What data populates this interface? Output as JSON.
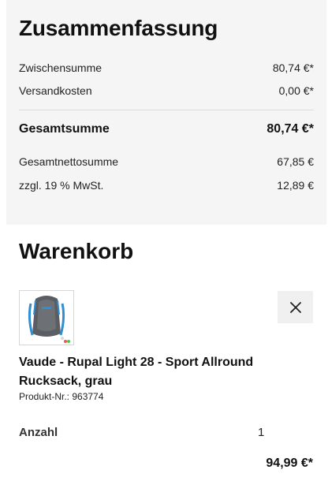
{
  "summary": {
    "title": "Zusammenfassung",
    "subtotal_label": "Zwischensumme",
    "subtotal_value": "80,74 €*",
    "shipping_label": "Versandkosten",
    "shipping_value": "0,00 €*",
    "total_label": "Gesamtsumme",
    "total_value": "80,74 €*",
    "net_label": "Gesamtnettosumme",
    "net_value": "67,85 €",
    "vat_label": "zzgl. 19 % MwSt.",
    "vat_value": "12,89 €"
  },
  "cart": {
    "title": "Warenkorb",
    "item": {
      "image_icon": "backpack-image",
      "remove_icon": "close-icon",
      "name": "Vaude - Rupal Light 28 - Sport Allround Rucksack, grau",
      "product_number": "Produkt-Nr.: 963774",
      "quantity_label": "Anzahl",
      "quantity_value": "1",
      "price": "94,99 €*"
    }
  },
  "colors": {
    "summary_bg": "#f5f5f5",
    "remove_button_bg": "#f0f0f0",
    "backpack_accent": "#2f8fd0"
  }
}
